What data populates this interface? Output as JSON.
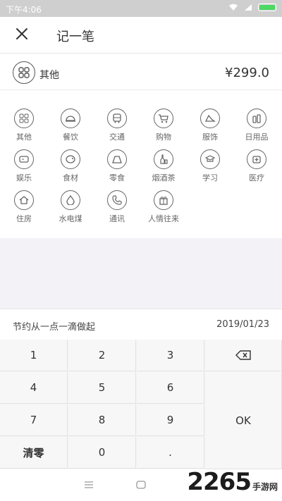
{
  "status_bar": {
    "time": "下午4:06"
  },
  "header": {
    "close_icon": "close-icon",
    "title": "记一笔"
  },
  "summary": {
    "category_icon": "other-icon",
    "category": "其他",
    "amount": "¥299.0"
  },
  "categories": [
    {
      "label": "其他",
      "icon": "other-icon"
    },
    {
      "label": "餐饮",
      "icon": "dining-icon"
    },
    {
      "label": "交通",
      "icon": "bus-icon"
    },
    {
      "label": "购物",
      "icon": "cart-icon"
    },
    {
      "label": "服饰",
      "icon": "clothing-icon"
    },
    {
      "label": "日用品",
      "icon": "daily-goods-icon"
    },
    {
      "label": "娱乐",
      "icon": "entertainment-icon"
    },
    {
      "label": "食材",
      "icon": "ingredients-icon"
    },
    {
      "label": "零食",
      "icon": "snack-icon"
    },
    {
      "label": "烟酒茶",
      "icon": "drink-icon"
    },
    {
      "label": "学习",
      "icon": "study-icon"
    },
    {
      "label": "医疗",
      "icon": "medical-icon"
    },
    {
      "label": "住房",
      "icon": "house-icon"
    },
    {
      "label": "水电煤",
      "icon": "utilities-icon"
    },
    {
      "label": "通讯",
      "icon": "phone-icon"
    },
    {
      "label": "人情往来",
      "icon": "gift-icon"
    }
  ],
  "note": {
    "text": "节约从一点一滴做起",
    "date": "2019/01/23"
  },
  "keypad": {
    "k1": "1",
    "k2": "2",
    "k3": "3",
    "k4": "4",
    "k5": "5",
    "k6": "6",
    "k7": "7",
    "k8": "8",
    "k9": "9",
    "clear": "清零",
    "k0": "0",
    "dot": ".",
    "ok": "OK",
    "backspace_icon": "backspace-icon"
  },
  "watermark": {
    "brand": "2265",
    "site": "手游网"
  }
}
